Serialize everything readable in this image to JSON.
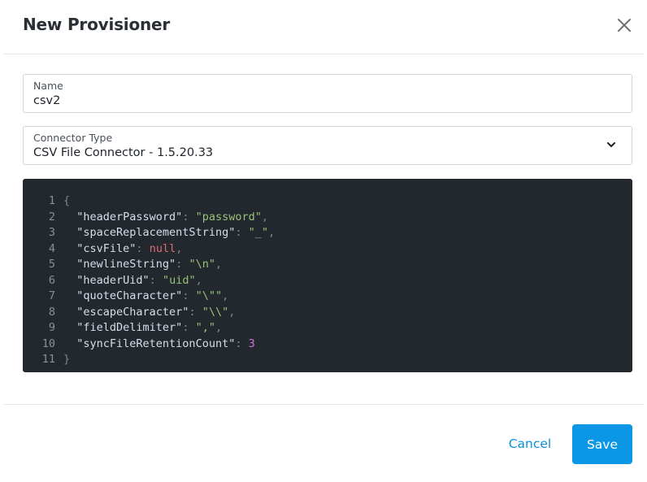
{
  "dialog": {
    "title": "New Provisioner",
    "close_icon": "close-icon"
  },
  "form": {
    "name": {
      "label": "Name",
      "value": "csv2"
    },
    "connector_type": {
      "label": "Connector Type",
      "value": "CSV File Connector - 1.5.20.33",
      "icon": "chevron-down-icon"
    }
  },
  "editor": {
    "lines": [
      {
        "number": "1",
        "text": "{"
      },
      {
        "number": "2",
        "key": "\"headerPassword\"",
        "value": "\"password\"",
        "value_type": "string",
        "comma": ","
      },
      {
        "number": "3",
        "key": "\"spaceReplacementString\"",
        "value": "\"_\"",
        "value_type": "string",
        "comma": ","
      },
      {
        "number": "4",
        "key": "\"csvFile\"",
        "value": "null",
        "value_type": "null",
        "comma": ","
      },
      {
        "number": "5",
        "key": "\"newlineString\"",
        "value": "\"\\n\"",
        "value_type": "string",
        "comma": ","
      },
      {
        "number": "6",
        "key": "\"headerUid\"",
        "value": "\"uid\"",
        "value_type": "string",
        "comma": ","
      },
      {
        "number": "7",
        "key": "\"quoteCharacter\"",
        "value": "\"\\\"\"",
        "value_type": "string",
        "comma": ","
      },
      {
        "number": "8",
        "key": "\"escapeCharacter\"",
        "value": "\"\\\\\"",
        "value_type": "string",
        "comma": ","
      },
      {
        "number": "9",
        "key": "\"fieldDelimiter\"",
        "value": "\",\"",
        "value_type": "string",
        "comma": ","
      },
      {
        "number": "10",
        "key": "\"syncFileRetentionCount\"",
        "value": "3",
        "value_type": "number",
        "comma": ""
      },
      {
        "number": "11",
        "text": "}"
      }
    ]
  },
  "footer": {
    "cancel_label": "Cancel",
    "save_label": "Save"
  },
  "colors": {
    "accent": "#0b97e6",
    "link": "#0a8fd8",
    "editor_bg": "#23272e"
  }
}
